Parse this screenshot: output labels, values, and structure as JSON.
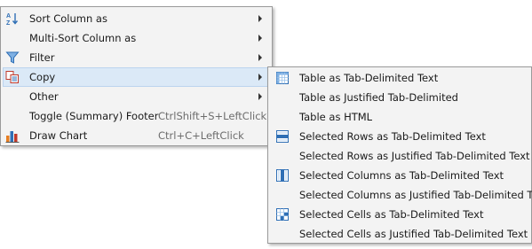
{
  "main_menu": {
    "items": [
      {
        "label": "Sort Column as",
        "icon": "sort-az-icon",
        "has_submenu": true
      },
      {
        "label": "Multi-Sort Column as",
        "icon": "",
        "has_submenu": true
      },
      {
        "label": "Filter",
        "icon": "filter-icon",
        "has_submenu": true
      },
      {
        "label": "Copy",
        "icon": "copy-icon",
        "has_submenu": true,
        "active": true
      },
      {
        "label": "Other",
        "icon": "",
        "has_submenu": true
      },
      {
        "label": "Toggle (Summary) Footer",
        "shortcut": "CtrlShift+S+LeftClick",
        "icon": ""
      },
      {
        "label": "Draw Chart",
        "shortcut": "Ctrl+C+LeftClick",
        "icon": "bar-chart-icon"
      }
    ]
  },
  "copy_submenu": {
    "items": [
      {
        "label": "Table as Tab-Delimited Text",
        "icon": "table-icon"
      },
      {
        "label": "Table as Justified Tab-Delimited",
        "icon": ""
      },
      {
        "label": "Table as HTML",
        "icon": ""
      },
      {
        "label": "Selected Rows as Tab-Delimited Text",
        "icon": "selected-rows-icon"
      },
      {
        "label": "Selected Rows as Justified Tab-Delimited Text",
        "icon": ""
      },
      {
        "label": "Selected Columns as Tab-Delimited Text",
        "icon": "selected-columns-icon"
      },
      {
        "label": "Selected Columns as Justified Tab-Delimited Text",
        "icon": ""
      },
      {
        "label": "Selected Cells as Tab-Delimited Text",
        "icon": "selected-cells-icon"
      },
      {
        "label": "Selected Cells as Justified Tab-Delimited Text",
        "icon": ""
      }
    ]
  },
  "colors": {
    "menu_background": "#f3f3f3",
    "highlight": "#dbe9f7",
    "icon_blue": "#2f6fb5",
    "icon_red": "#c0392b"
  }
}
